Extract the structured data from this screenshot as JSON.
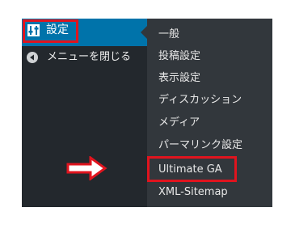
{
  "sidebar": {
    "active_item": {
      "label": "設定",
      "icon": "settings-sliders-icon"
    },
    "collapse": {
      "label": "メニューを閉じる",
      "icon": "collapse-arrow-icon"
    }
  },
  "submenu": {
    "items": [
      {
        "label": "一般"
      },
      {
        "label": "投稿設定"
      },
      {
        "label": "表示設定"
      },
      {
        "label": "ディスカッション"
      },
      {
        "label": "メディア"
      },
      {
        "label": "パーマリンク設定"
      },
      {
        "label": "Ultimate GA",
        "highlighted": true
      },
      {
        "label": "XML-Sitemap"
      }
    ]
  },
  "colors": {
    "sidebar_bg": "#23282d",
    "submenu_bg": "#32373c",
    "active_bg": "#0073aa",
    "highlight": "#e0141e"
  },
  "annotation": {
    "arrow_icon": "right-arrow-icon"
  }
}
